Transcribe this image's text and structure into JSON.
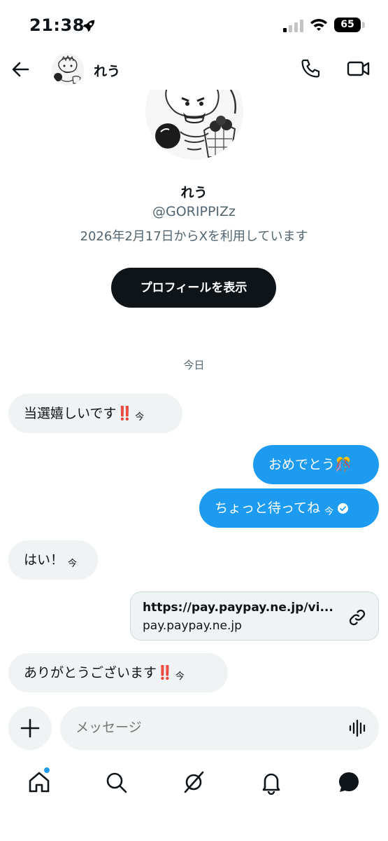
{
  "status_bar": {
    "time": "21:38",
    "battery": "65"
  },
  "header": {
    "name": "れう"
  },
  "profile": {
    "name": "れう",
    "handle": "@GORIPPIZz",
    "joined": "2026年2月17日からXを利用しています",
    "view_profile_label": "プロフィールを表示"
  },
  "date_separator": "今日",
  "messages": [
    {
      "direction": "received",
      "text": "当選嬉しいです",
      "emoji": "‼️",
      "time": "今"
    },
    {
      "direction": "sent",
      "text": "おめでとう",
      "emoji": "🎊"
    },
    {
      "direction": "sent",
      "text": "ちょっと待ってね",
      "time": "今"
    },
    {
      "direction": "received",
      "text": "はい！",
      "time": "今"
    },
    {
      "direction": "received",
      "text": "ありがとうございます",
      "emoji": "‼️",
      "time": "今"
    }
  ],
  "link_card": {
    "url": "https://pay.paypay.ne.jp/vi...",
    "domain": "pay.paypay.ne.jp"
  },
  "composer": {
    "placeholder": "メッセージ"
  },
  "tabs": [
    {
      "icon": "home-icon"
    },
    {
      "icon": "search-icon"
    },
    {
      "icon": "grok-icon"
    },
    {
      "icon": "bell-icon"
    },
    {
      "icon": "messages-icon"
    }
  ],
  "colors": {
    "accent": "#1d9bf0",
    "text": "#0f1419",
    "secondary": "#536471",
    "bubble_received": "#eff3f4",
    "dark_button": "#0f1419"
  }
}
